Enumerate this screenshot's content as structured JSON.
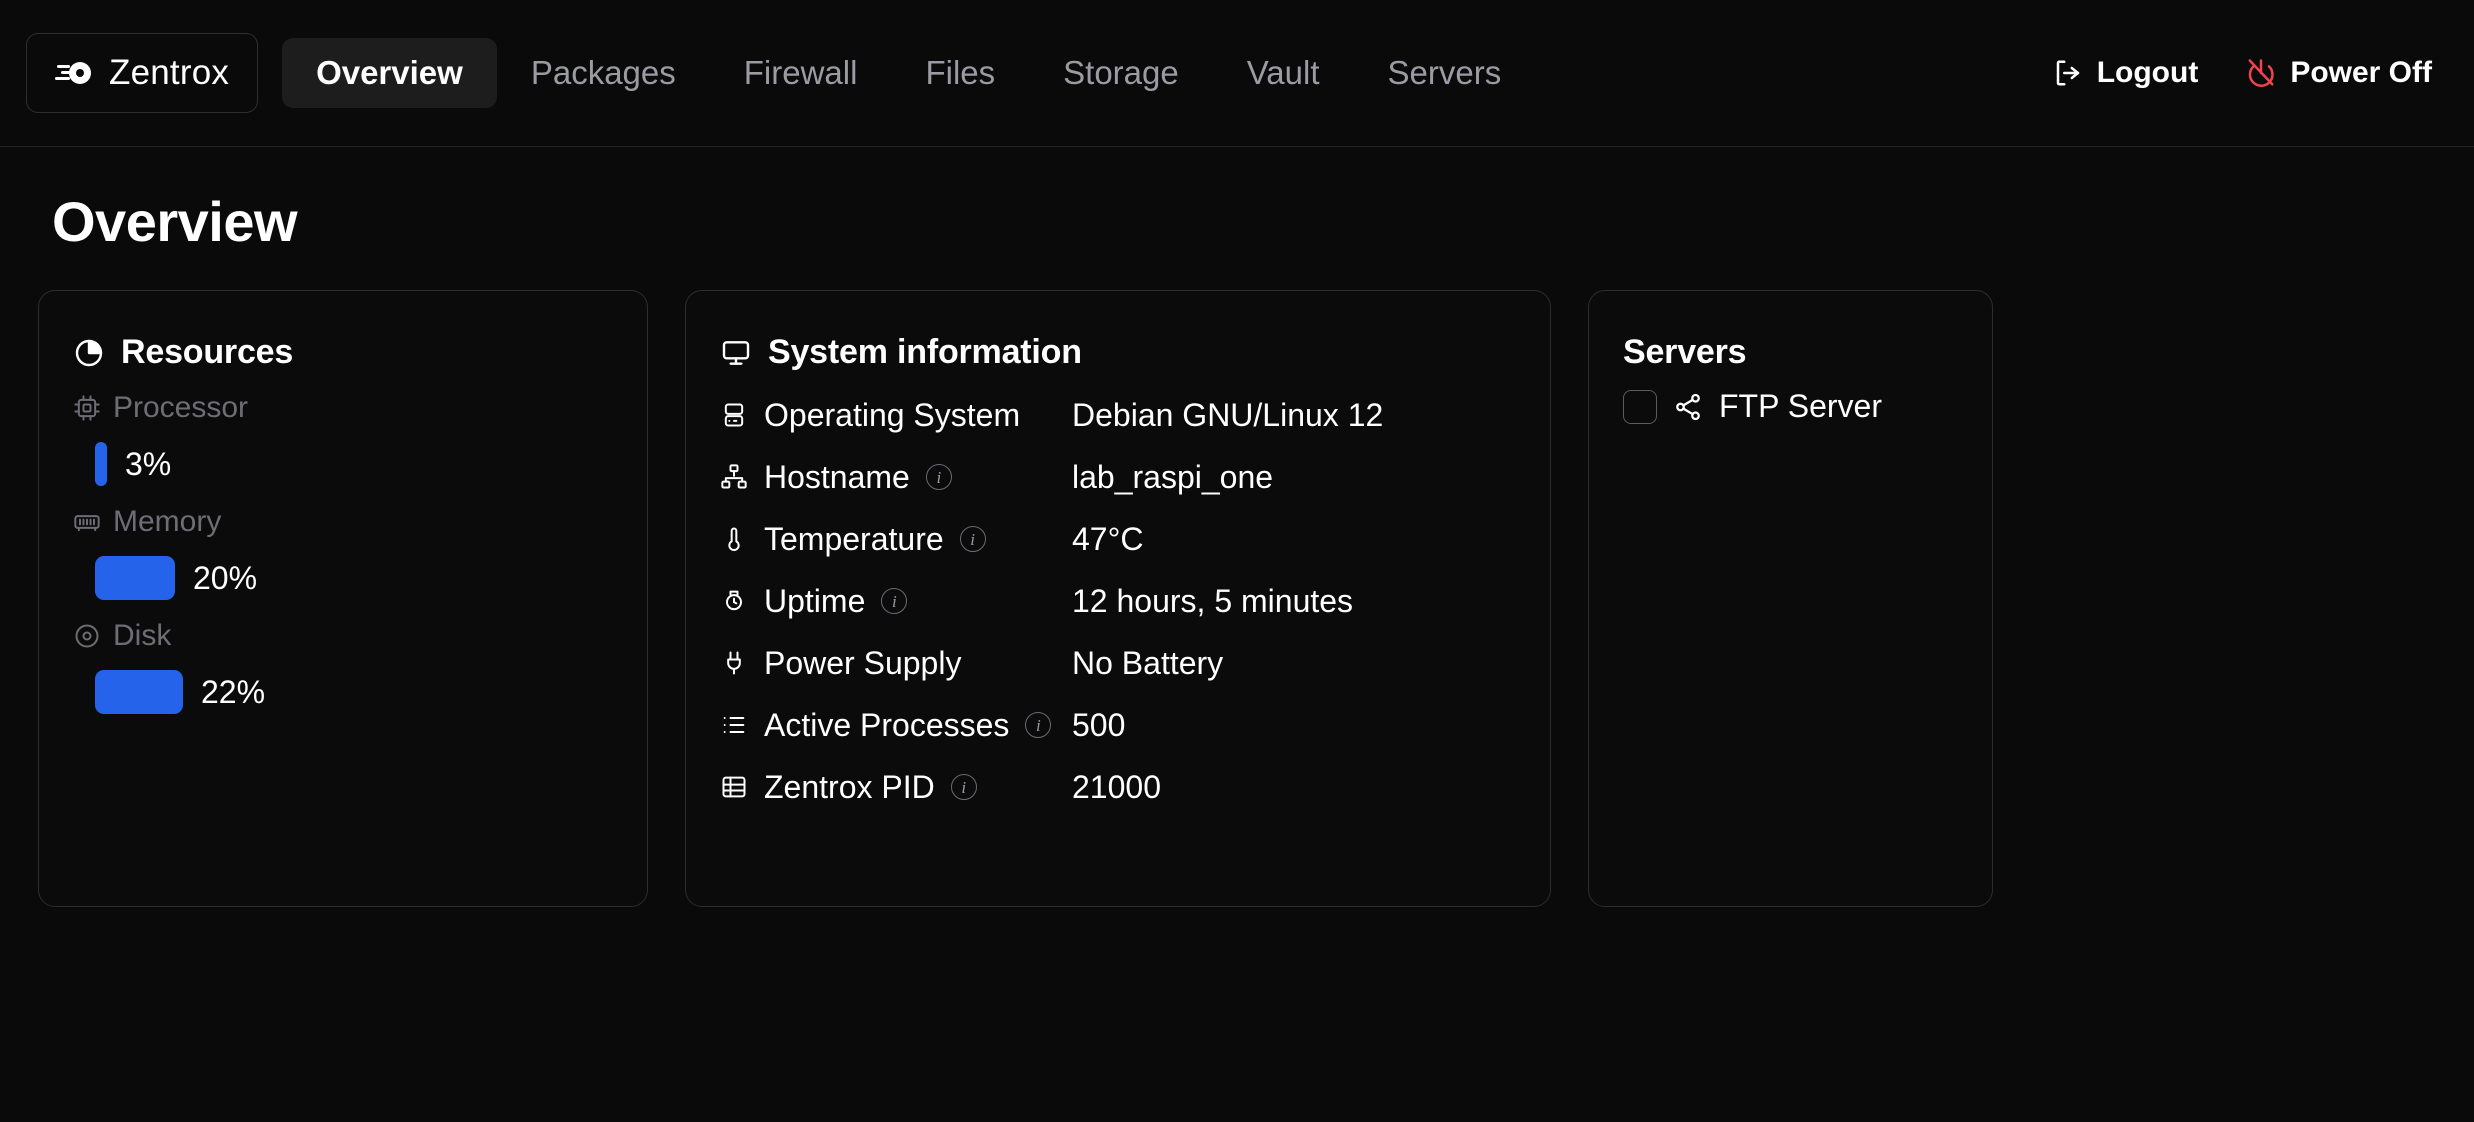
{
  "brand": {
    "label": "Zentrox",
    "icon": "zentrox-disc-logo"
  },
  "nav": {
    "tabs": [
      {
        "label": "Overview",
        "active": true
      },
      {
        "label": "Packages",
        "active": false
      },
      {
        "label": "Firewall",
        "active": false
      },
      {
        "label": "Files",
        "active": false
      },
      {
        "label": "Storage",
        "active": false
      },
      {
        "label": "Vault",
        "active": false
      },
      {
        "label": "Servers",
        "active": false
      }
    ],
    "actions": [
      {
        "label": "Logout",
        "icon": "logout-icon",
        "color": "#ffffff"
      },
      {
        "label": "Power Off",
        "icon": "power-off-icon",
        "color": "#f0424f"
      }
    ]
  },
  "page": {
    "title": "Overview"
  },
  "resources": {
    "title": "Resources",
    "icon": "pie-chart-icon",
    "items": [
      {
        "label": "Processor",
        "icon": "cpu-icon",
        "value": "3%",
        "percent": 3
      },
      {
        "label": "Memory",
        "icon": "memory-icon",
        "value": "20%",
        "percent": 20
      },
      {
        "label": "Disk",
        "icon": "disk-icon",
        "value": "22%",
        "percent": 22
      }
    ],
    "bar_color": "#2563eb"
  },
  "system_information": {
    "title": "System information",
    "icon": "monitor-icon",
    "rows": [
      {
        "label": "Operating System",
        "icon": "server-icon",
        "value": "Debian GNU/Linux 12",
        "info": false
      },
      {
        "label": "Hostname",
        "icon": "network-icon",
        "value": "lab_raspi_one",
        "info": true
      },
      {
        "label": "Temperature",
        "icon": "thermometer-icon",
        "value": "47°C",
        "info": true
      },
      {
        "label": "Uptime",
        "icon": "watch-icon",
        "value": "12 hours, 5 minutes",
        "info": true
      },
      {
        "label": "Power Supply",
        "icon": "plug-icon",
        "value": "No Battery",
        "info": false
      },
      {
        "label": "Active Processes",
        "icon": "list-icon",
        "value": "500",
        "info": true
      },
      {
        "label": "Zentrox PID",
        "icon": "table-icon",
        "value": "21000",
        "info": true
      }
    ]
  },
  "servers": {
    "title": "Servers",
    "items": [
      {
        "label": "FTP Server",
        "icon": "share-network-icon",
        "checked": false
      }
    ]
  },
  "colors": {
    "background": "#0a0a0a",
    "card_border": "#2d2d2d",
    "accent_blue": "#2563eb",
    "muted_text": "#6d6d75",
    "inactive_tab": "#9b9ba3",
    "danger": "#f0424f"
  }
}
